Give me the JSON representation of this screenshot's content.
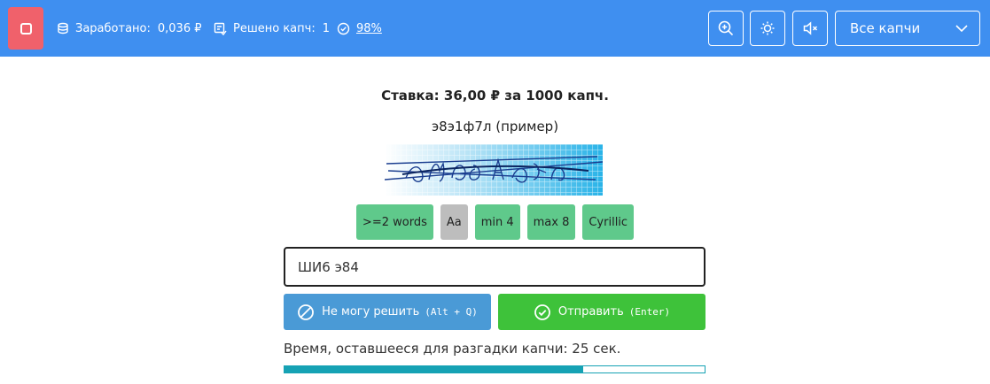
{
  "topbar": {
    "stop_icon": "stop-icon",
    "earned_label": "Заработано:",
    "earned_value": "0,036 ₽",
    "solved_label": "Решено капч:",
    "solved_value": "1",
    "accuracy_value": "98%",
    "zoom_icon": "zoom-in-icon",
    "theme_icon": "brightness-icon",
    "mute_icon": "volume-mute-icon",
    "filter_select": "Все капчи",
    "accent_color": "#3f8ff0"
  },
  "main": {
    "rate": "Ставка: 36,00 ₽ за 1000 капч.",
    "example": "э8э1ф7л (пример)",
    "tags": [
      {
        "label": ">=2 words",
        "active": true
      },
      {
        "label": "Aa",
        "active": false
      },
      {
        "label": "min 4",
        "active": true
      },
      {
        "label": "max 8",
        "active": true
      },
      {
        "label": "Cyrillic",
        "active": true
      }
    ],
    "answer_value": "ШИ6 э84",
    "skip_label": "Не могу решить",
    "skip_shortcut": "(Alt + Q)",
    "send_label": "Отправить",
    "send_shortcut": "(Enter)",
    "timer_text": "Время, оставшееся для разгадки капчи: 25 сек.",
    "timer_progress": 0.71
  }
}
